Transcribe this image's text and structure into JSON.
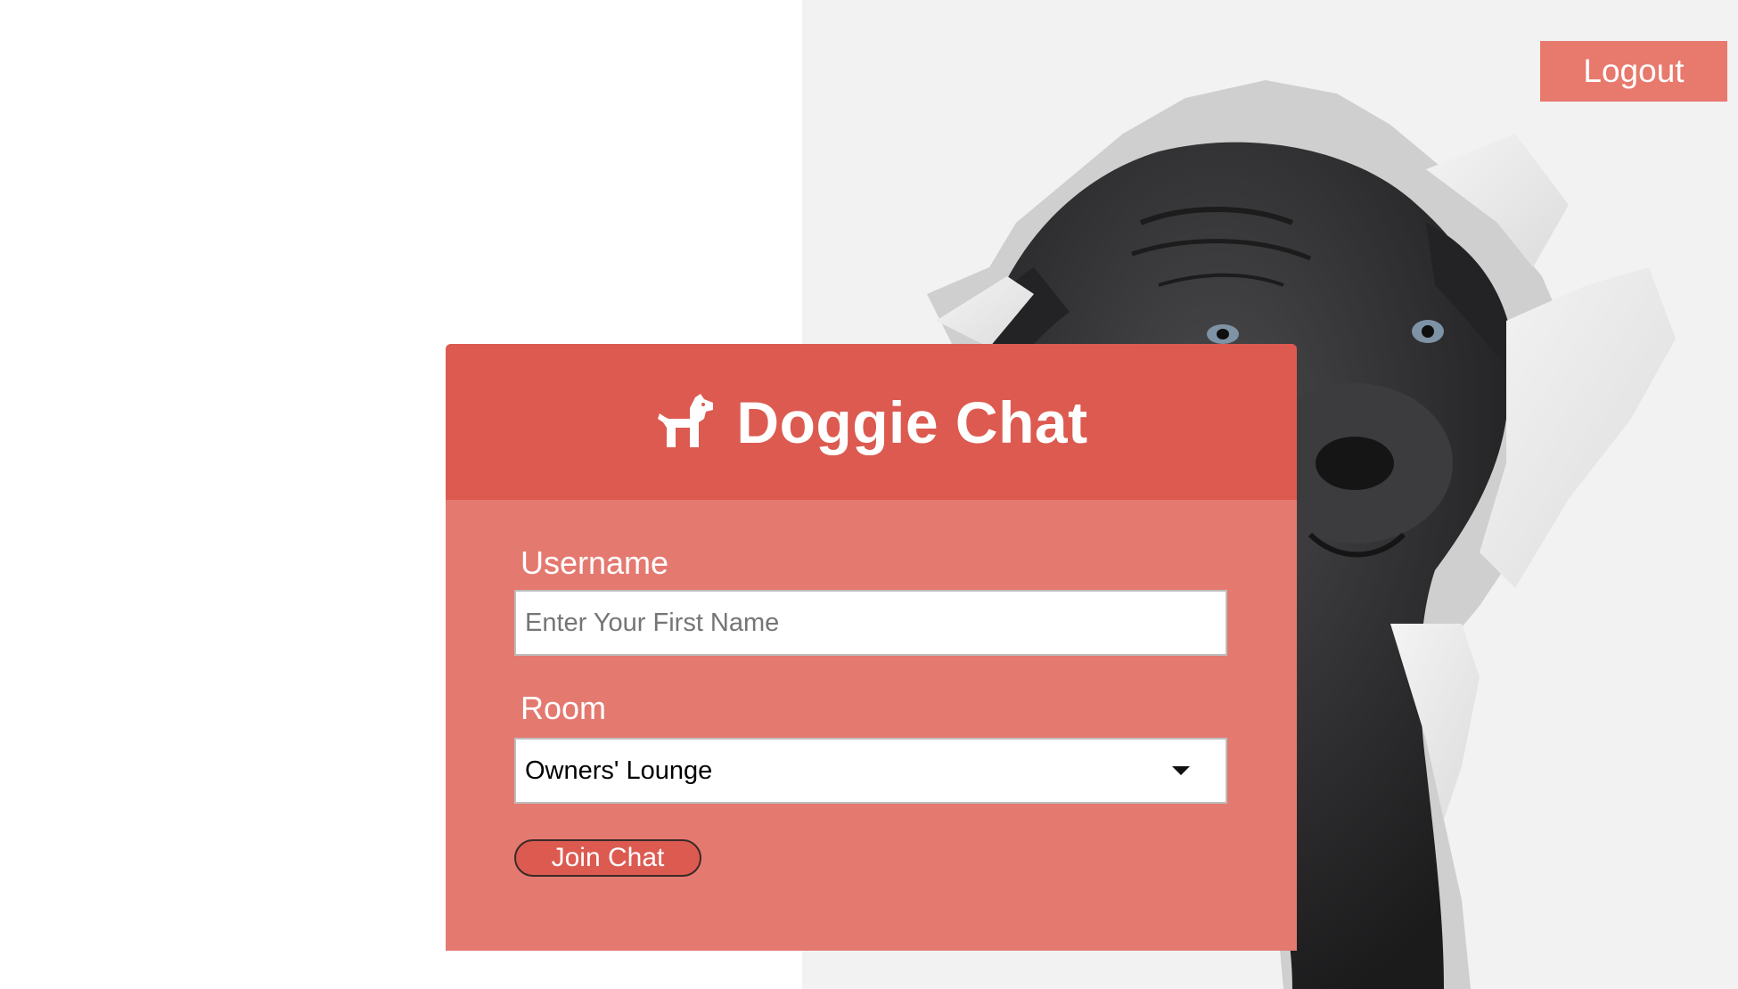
{
  "header": {
    "logout_label": "Logout"
  },
  "card": {
    "title": "Doggie Chat",
    "icon": "dog-icon",
    "username_label": "Username",
    "username_placeholder": "Enter Your First Name",
    "username_value": "",
    "room_label": "Room",
    "room_selected": "Owners' Lounge",
    "join_label": "Join Chat"
  },
  "colors": {
    "header_bg": "#dc5a50",
    "card_bg": "#e47970",
    "logout_bg": "#e8796d",
    "text_on_accent": "#ffffff"
  }
}
